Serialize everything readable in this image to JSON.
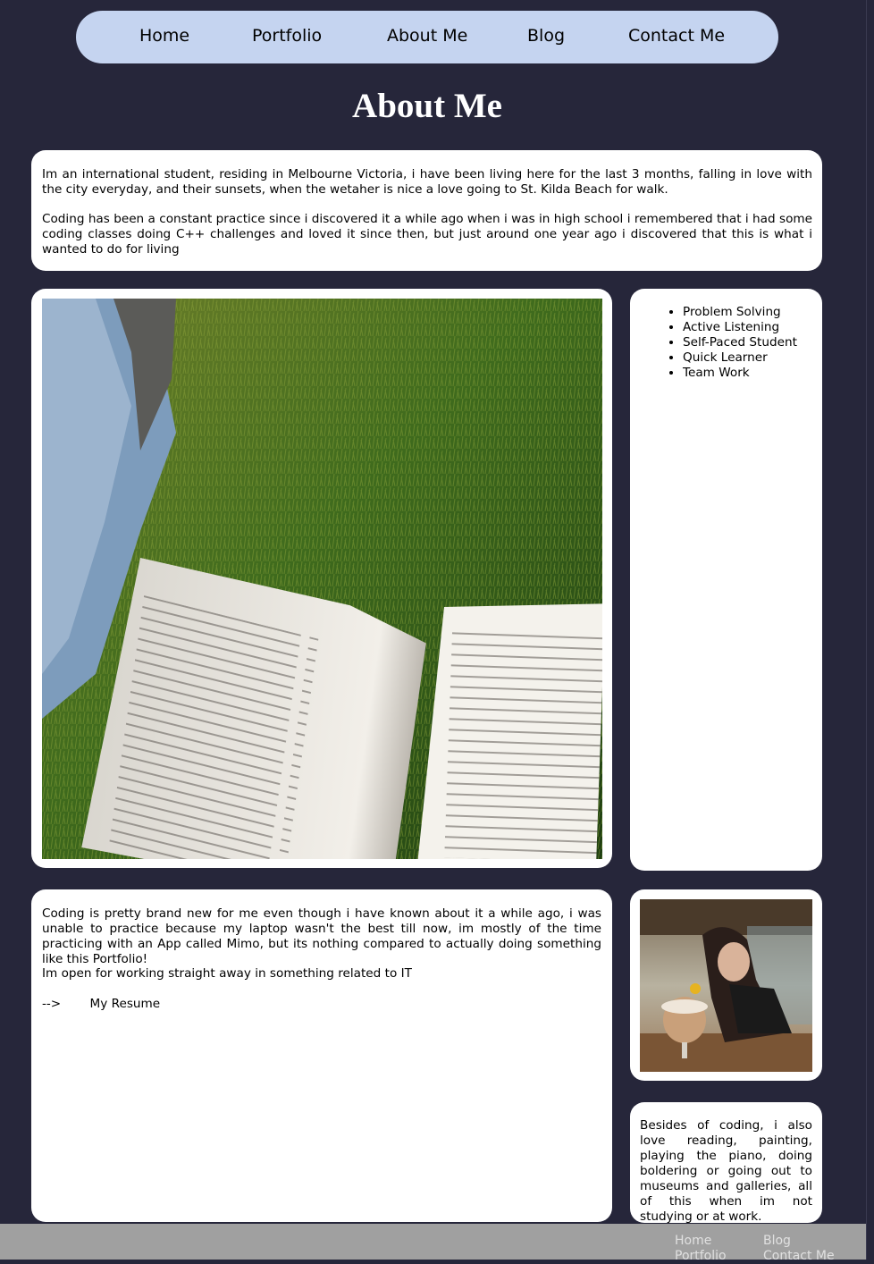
{
  "nav": {
    "items": [
      {
        "label": "Home"
      },
      {
        "label": "Portfolio"
      },
      {
        "label": "About Me"
      },
      {
        "label": "Blog"
      },
      {
        "label": "Contact Me"
      }
    ]
  },
  "page": {
    "title": "About Me"
  },
  "intro": {
    "paragraph1": "Im an international student, residing in Melbourne Victoria, i have been living here for the last 3 months, falling in love with the city everyday, and their sunsets, when the wetaher is nice a love going to St. Kilda Beach for walk.",
    "paragraph2": "Coding has been a constant practice since i discovered it a while ago when i was in high school i remembered that i had some coding classes doing C++ challenges and loved it since then, but just around one year ago i discovered that this is what i wanted to do for living"
  },
  "skills": {
    "items": [
      "Problem Solving",
      "Active Listening",
      "Self-Paced Student",
      "Quick Learner",
      "Team Work"
    ]
  },
  "coding": {
    "paragraph1": "Coding is pretty brand new for me even though i have known about it a while ago, i was unable to practice because my laptop wasn't the best till now, im mostly of the time practicing with an App called Mimo, but its nothing compared to actually doing something like this Portfolio!",
    "paragraph2": "Im open for working straight away in something related to IT",
    "resume_arrow": "-->",
    "resume_link": "My Resume"
  },
  "hobby": {
    "text": "Besides of coding, i also love reading, painting, playing the piano, doing boldering or going out to museums and galleries, all of this when im not studying or at work."
  },
  "footer": {
    "items": [
      {
        "label": "Home"
      },
      {
        "label": "Blog"
      },
      {
        "label": "Portfolio"
      },
      {
        "label": "Contact Me"
      }
    ]
  },
  "colors": {
    "background": "#26263a",
    "nav": "#c5d4f0",
    "card": "#ffffff",
    "footer": "#a0a0a0"
  }
}
